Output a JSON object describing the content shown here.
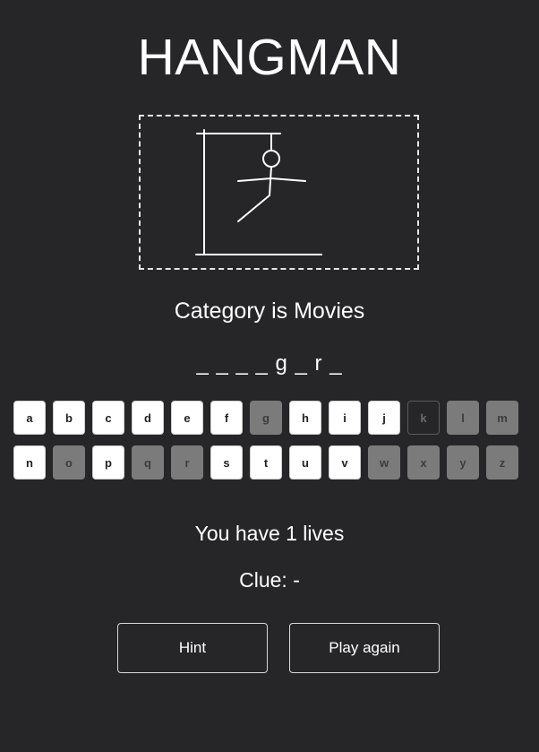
{
  "title": "HANGMAN",
  "category_text": "Category is Movies",
  "word_display": "_ _ _ _ g _ r _",
  "keyboard": {
    "rows": [
      [
        {
          "letter": "a",
          "state": "available"
        },
        {
          "letter": "b",
          "state": "available"
        },
        {
          "letter": "c",
          "state": "available"
        },
        {
          "letter": "d",
          "state": "available"
        },
        {
          "letter": "e",
          "state": "available"
        },
        {
          "letter": "f",
          "state": "available"
        },
        {
          "letter": "g",
          "state": "used"
        },
        {
          "letter": "h",
          "state": "available"
        },
        {
          "letter": "i",
          "state": "available"
        },
        {
          "letter": "j",
          "state": "available"
        },
        {
          "letter": "k",
          "state": "focused"
        },
        {
          "letter": "l",
          "state": "used"
        },
        {
          "letter": "m",
          "state": "used"
        }
      ],
      [
        {
          "letter": "n",
          "state": "available"
        },
        {
          "letter": "o",
          "state": "used"
        },
        {
          "letter": "p",
          "state": "available"
        },
        {
          "letter": "q",
          "state": "used"
        },
        {
          "letter": "r",
          "state": "used"
        },
        {
          "letter": "s",
          "state": "available"
        },
        {
          "letter": "t",
          "state": "available"
        },
        {
          "letter": "u",
          "state": "available"
        },
        {
          "letter": "v",
          "state": "available"
        },
        {
          "letter": "w",
          "state": "used"
        },
        {
          "letter": "x",
          "state": "used"
        },
        {
          "letter": "y",
          "state": "used"
        },
        {
          "letter": "z",
          "state": "used"
        }
      ]
    ]
  },
  "lives_text": "You have 1 lives",
  "clue_text": "Clue: -",
  "buttons": {
    "hint": "Hint",
    "play_again": "Play again"
  },
  "colors": {
    "background": "#262628",
    "used_key": "#7b7b7b",
    "available_key": "#ffffff"
  }
}
